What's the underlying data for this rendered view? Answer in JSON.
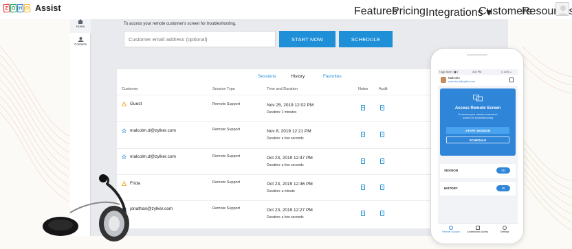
{
  "brand": {
    "logo_letters": [
      "Z",
      "O",
      "H",
      "O"
    ],
    "product": "Assist"
  },
  "nav": {
    "links": [
      {
        "label": "Features",
        "has_dropdown": false
      },
      {
        "label": "Pricing",
        "has_dropdown": false
      },
      {
        "label": "Integrations ▾",
        "has_dropdown": true
      },
      {
        "label": "Customers",
        "has_dropdown": false
      },
      {
        "label": "Resources",
        "has_dropdown": false
      }
    ]
  },
  "sidebar": {
    "items": [
      {
        "label": "Home",
        "icon": "home-icon"
      },
      {
        "label": "Contacts",
        "icon": "contacts-icon"
      }
    ]
  },
  "session": {
    "description": "To access your remote customer's screen for troubleshooting.",
    "email_placeholder": "Customer email address (optional)",
    "start_label": "START NOW",
    "schedule_label": "SCHEDULE"
  },
  "tabs": [
    {
      "label": "Sessions"
    },
    {
      "label": "History"
    },
    {
      "label": "Favorites"
    }
  ],
  "active_tab": "History",
  "table": {
    "columns": [
      "Customer",
      "Session Type",
      "Time and Duration",
      "Notes",
      "Audit"
    ],
    "rows": [
      {
        "customer": "Guest",
        "icon": "warning-icon",
        "type": "Remote Support",
        "time": "Nov 25, 2019 12:02 PM",
        "duration": "Duration: 2 minutes"
      },
      {
        "customer": "malcolm.d@zylker.com",
        "icon": "star-icon",
        "type": "Remote Support",
        "time": "Nov 8, 2019 12:21 PM",
        "duration": "Duration: a few seconds"
      },
      {
        "customer": "malcolm.d@zylker.com",
        "icon": "star-icon",
        "type": "Remote Support",
        "time": "Oct 23, 2019 12:47 PM",
        "duration": "Duration: a few seconds"
      },
      {
        "customer": "Frida",
        "icon": "warning-icon",
        "type": "Remote Support",
        "time": "Oct 23, 2019 12:36 PM",
        "duration": "Duration: a minute"
      },
      {
        "customer": "jonathan@zylker.com",
        "icon": "star-icon",
        "type": "Remote Support",
        "time": "Oct 23, 2019 12:27 PM",
        "duration": "Duration: a few seconds"
      }
    ]
  },
  "phone": {
    "status_left": "▪ App Store ▪ ▮▮ ◐",
    "status_time": "4:31 PM",
    "status_right": "◷ 41% ▭",
    "user_name": "Malcolm",
    "user_email": "malcolm.d@zylker.com",
    "card_title": "Access Remote Screen",
    "card_desc_line1": "To access your remote customer's",
    "card_desc_line2": "screen for troubleshooting",
    "start_label": "START SESSION",
    "schedule_label": "SCHEDULE",
    "rows": [
      {
        "label": "SESSION",
        "count": "00"
      },
      {
        "label": "HISTORY",
        "count": "15"
      }
    ],
    "bottom_tabs": [
      "Remote Support",
      "Unattended Access",
      "Settings"
    ]
  },
  "colors": {
    "accent": "#1f90d8",
    "phone_accent": "#2f86d9",
    "panel_bg": "#e9eaee",
    "warning": "#f5a623"
  }
}
